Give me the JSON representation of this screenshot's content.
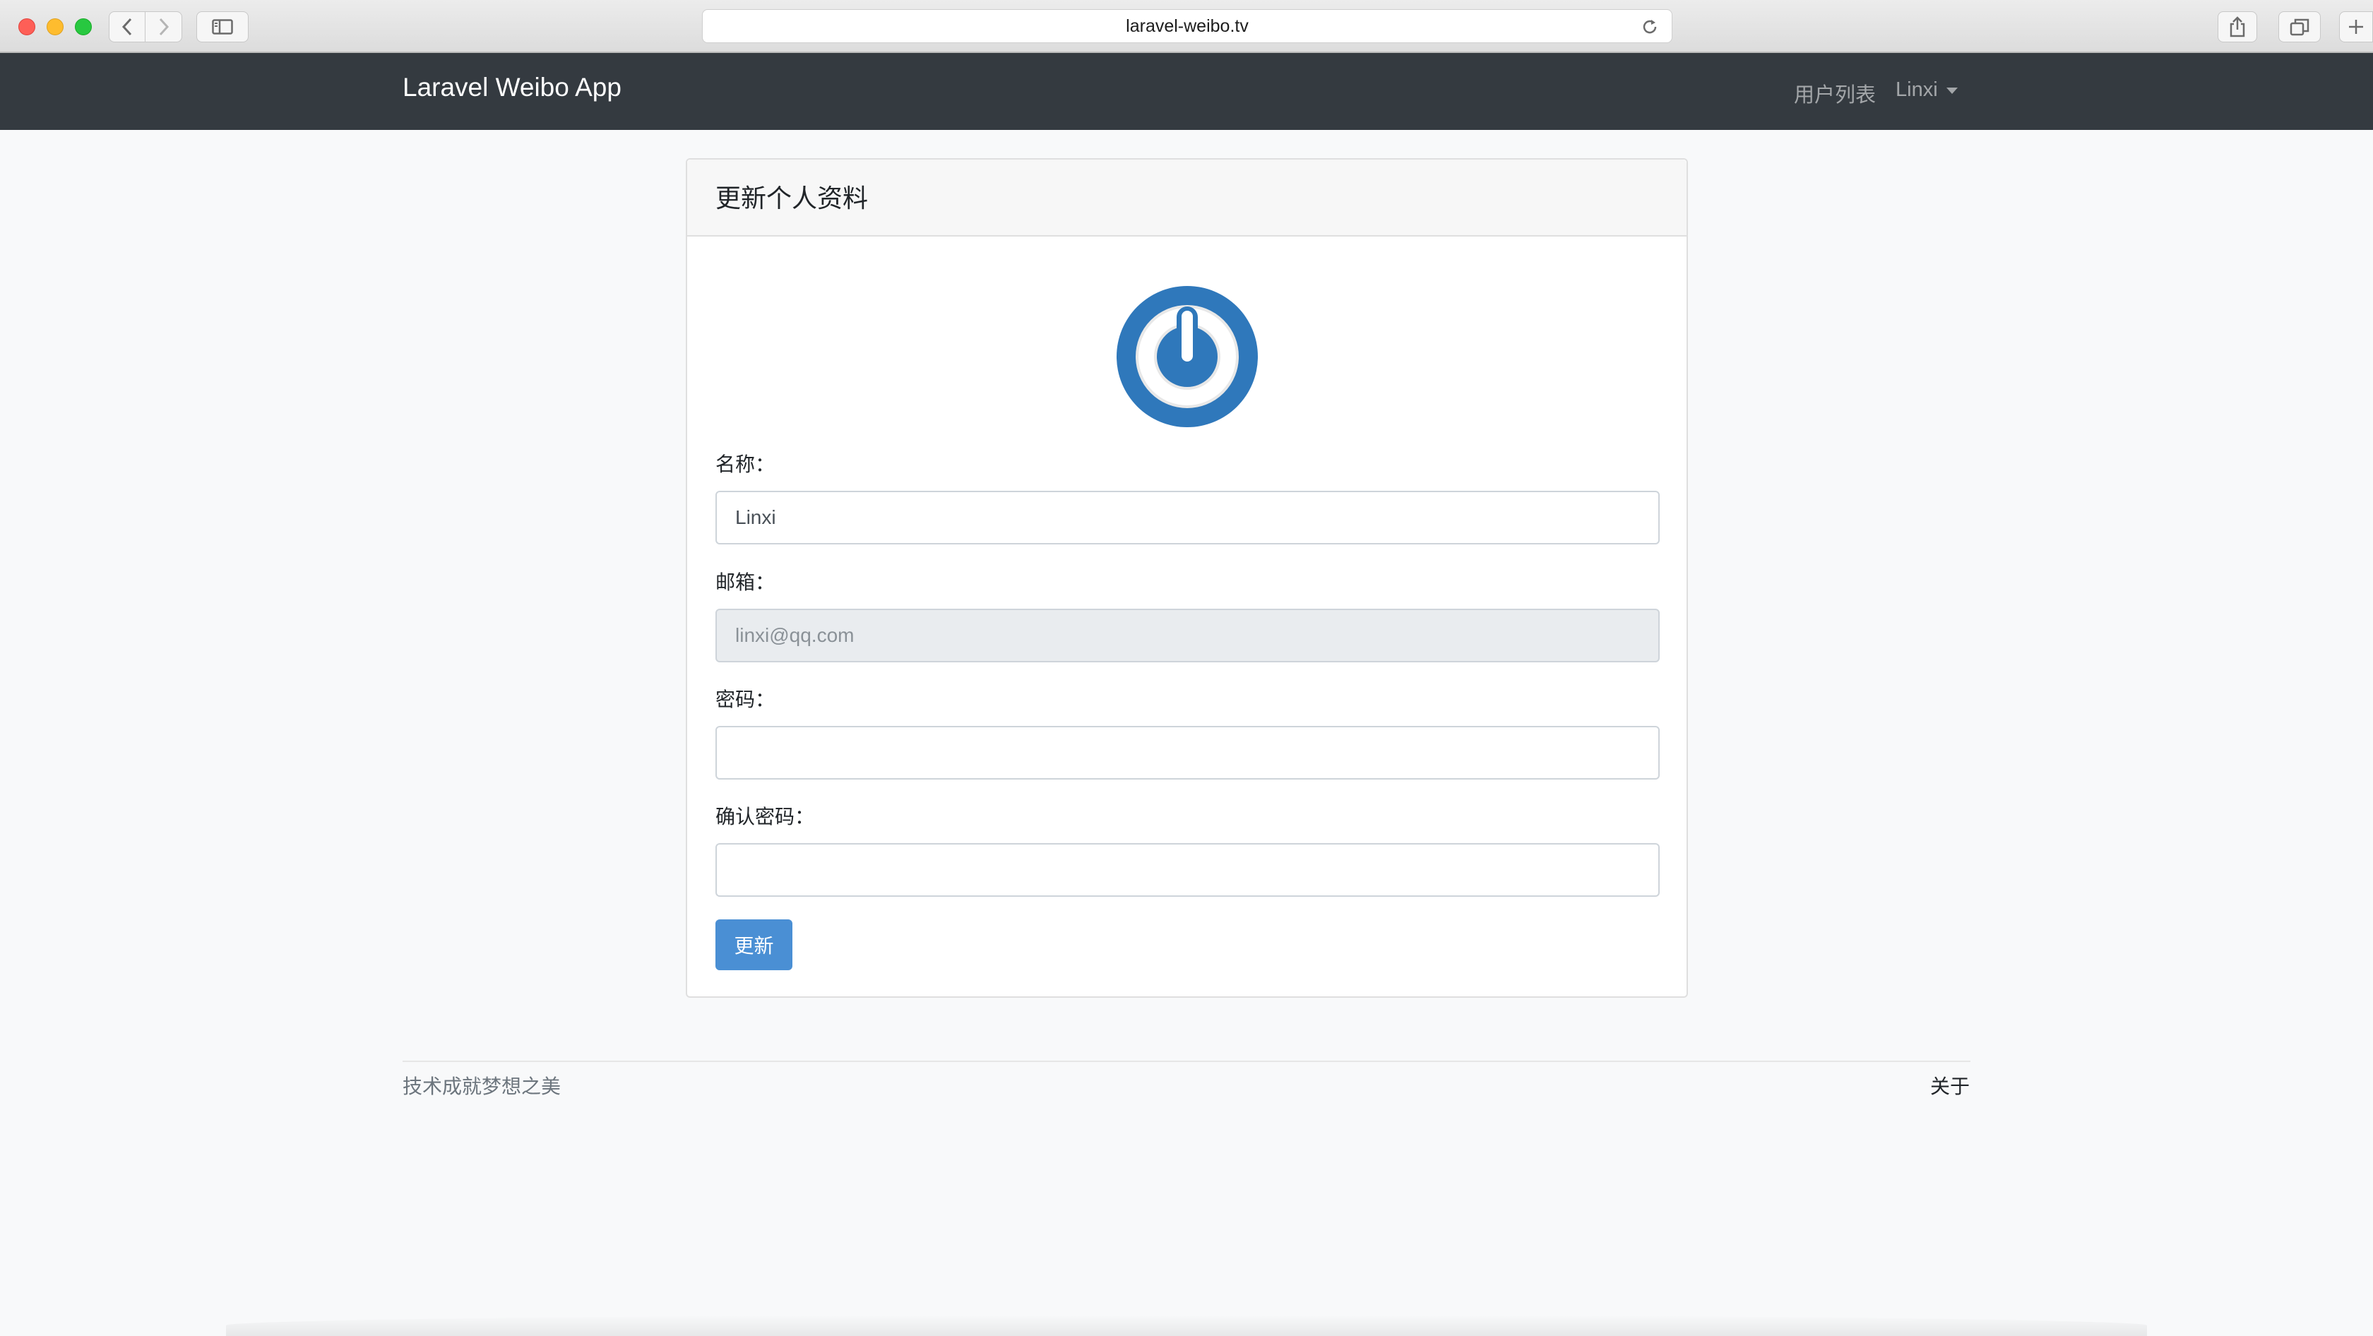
{
  "browser": {
    "url": "laravel-weibo.tv"
  },
  "navbar": {
    "brand": "Laravel Weibo App",
    "users_link": "用户列表",
    "user_menu": "Linxi"
  },
  "card": {
    "title": "更新个人资料",
    "avatar_color": "#2f78bb",
    "fields": {
      "name": {
        "label": "名称：",
        "value": "Linxi",
        "placeholder": ""
      },
      "email": {
        "label": "邮箱：",
        "value": "linxi@qq.com",
        "placeholder": ""
      },
      "password": {
        "label": "密码：",
        "value": "",
        "placeholder": ""
      },
      "confirm_password": {
        "label": "确认密码：",
        "value": "",
        "placeholder": ""
      }
    },
    "submit_label": "更新"
  },
  "footer": {
    "tagline": "技术成就梦想之美",
    "about": "关于"
  },
  "colors": {
    "navbar_bg": "#343a40",
    "primary_button": "#4a8fd4",
    "page_bg": "#f8f9fa"
  }
}
